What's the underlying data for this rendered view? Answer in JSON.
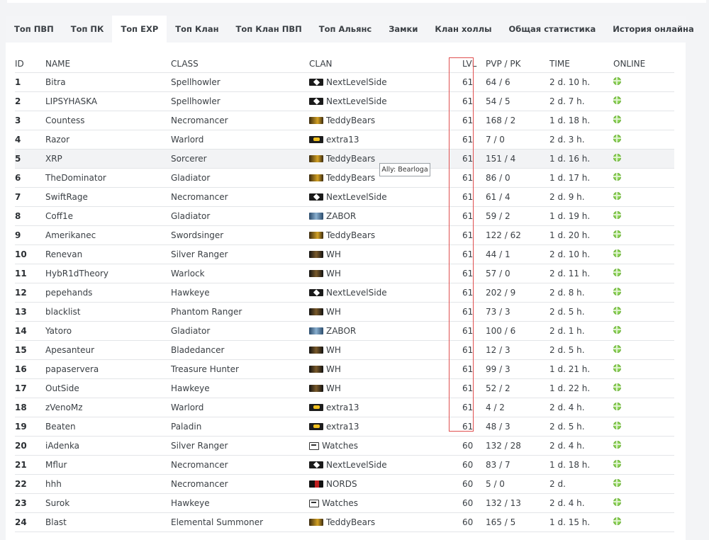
{
  "tabs": [
    {
      "label": "Топ ПВП",
      "active": false
    },
    {
      "label": "Топ ПК",
      "active": false
    },
    {
      "label": "Топ EXP",
      "active": true
    },
    {
      "label": "Топ Клан",
      "active": false
    },
    {
      "label": "Топ Клан ПВП",
      "active": false
    },
    {
      "label": "Топ Альянс",
      "active": false
    },
    {
      "label": "Замки",
      "active": false
    },
    {
      "label": "Клан холлы",
      "active": false
    },
    {
      "label": "Общая статистика",
      "active": false
    },
    {
      "label": "История онлайна",
      "active": false
    }
  ],
  "columns": [
    "ID",
    "NAME",
    "CLASS",
    "CLAN",
    "LVL",
    "PVP / PK",
    "TIME",
    "ONLINE"
  ],
  "rows": [
    {
      "id": "1",
      "name": "Bitra",
      "class": "Spellhowler",
      "clan": "NextLevelSide",
      "crest": "NextLevelSide-crest",
      "lvl": "61",
      "pvp": "64 / 6",
      "time": "2 d. 10 h."
    },
    {
      "id": "2",
      "name": "LIPSYHASKA",
      "class": "Spellhowler",
      "clan": "NextLevelSide",
      "crest": "NextLevelSide-crest",
      "lvl": "61",
      "pvp": "54 / 5",
      "time": "2 d. 7 h."
    },
    {
      "id": "3",
      "name": "Countess",
      "class": "Necromancer",
      "clan": "TeddyBears",
      "crest": "TeddyBears-crest",
      "lvl": "61",
      "pvp": "168 / 2",
      "time": "1 d. 18 h."
    },
    {
      "id": "4",
      "name": "Razor",
      "class": "Warlord",
      "clan": "extra13",
      "crest": "extra13-crest",
      "lvl": "61",
      "pvp": "7 / 0",
      "time": "2 d. 3 h."
    },
    {
      "id": "5",
      "name": "XRP",
      "class": "Sorcerer",
      "clan": "TeddyBears",
      "crest": "TeddyBears-crest",
      "lvl": "61",
      "pvp": "151 / 4",
      "time": "1 d. 16 h."
    },
    {
      "id": "6",
      "name": "TheDominator",
      "class": "Gladiator",
      "clan": "TeddyBears",
      "crest": "TeddyBears-crest",
      "lvl": "61",
      "pvp": "86 / 0",
      "time": "1 d. 17 h."
    },
    {
      "id": "7",
      "name": "SwiftRage",
      "class": "Necromancer",
      "clan": "NextLevelSide",
      "crest": "NextLevelSide-crest",
      "lvl": "61",
      "pvp": "61 / 4",
      "time": "2 d. 9 h."
    },
    {
      "id": "8",
      "name": "Coff1e",
      "class": "Gladiator",
      "clan": "ZABOR",
      "crest": "ZABOR-crest",
      "lvl": "61",
      "pvp": "59 / 2",
      "time": "1 d. 19 h."
    },
    {
      "id": "9",
      "name": "Amerikanec",
      "class": "Swordsinger",
      "clan": "TeddyBears",
      "crest": "TeddyBears-crest",
      "lvl": "61",
      "pvp": "122 / 62",
      "time": "1 d. 20 h."
    },
    {
      "id": "10",
      "name": "Renevan",
      "class": "Silver Ranger",
      "clan": "WH",
      "crest": "WH-crest",
      "lvl": "61",
      "pvp": "44 / 1",
      "time": "2 d. 10 h."
    },
    {
      "id": "11",
      "name": "HybR1dTheory",
      "class": "Warlock",
      "clan": "WH",
      "crest": "WH-crest",
      "lvl": "61",
      "pvp": "57 / 0",
      "time": "2 d. 11 h."
    },
    {
      "id": "12",
      "name": "pepehands",
      "class": "Hawkeye",
      "clan": "NextLevelSide",
      "crest": "NextLevelSide-crest",
      "lvl": "61",
      "pvp": "202 / 9",
      "time": "2 d. 8 h."
    },
    {
      "id": "13",
      "name": "blacklist",
      "class": "Phantom Ranger",
      "clan": "WH",
      "crest": "WH-crest",
      "lvl": "61",
      "pvp": "73 / 3",
      "time": "2 d. 5 h."
    },
    {
      "id": "14",
      "name": "Yatoro",
      "class": "Gladiator",
      "clan": "ZABOR",
      "crest": "ZABOR-crest",
      "lvl": "61",
      "pvp": "100 / 6",
      "time": "2 d. 1 h."
    },
    {
      "id": "15",
      "name": "Apesanteur",
      "class": "Bladedancer",
      "clan": "WH",
      "crest": "WH-crest",
      "lvl": "61",
      "pvp": "12 / 3",
      "time": "2 d. 5 h."
    },
    {
      "id": "16",
      "name": "papaservera",
      "class": "Treasure Hunter",
      "clan": "WH",
      "crest": "WH-crest",
      "lvl": "61",
      "pvp": "99 / 3",
      "time": "1 d. 21 h."
    },
    {
      "id": "17",
      "name": "OutSide",
      "class": "Hawkeye",
      "clan": "WH",
      "crest": "WH-crest",
      "lvl": "61",
      "pvp": "52 / 2",
      "time": "1 d. 22 h."
    },
    {
      "id": "18",
      "name": "zVenoMz",
      "class": "Warlord",
      "clan": "extra13",
      "crest": "extra13-crest",
      "lvl": "61",
      "pvp": "4 / 2",
      "time": "2 d. 4 h."
    },
    {
      "id": "19",
      "name": "Beaten",
      "class": "Paladin",
      "clan": "extra13",
      "crest": "extra13-crest",
      "lvl": "61",
      "pvp": "48 / 3",
      "time": "2 d. 5 h."
    },
    {
      "id": "20",
      "name": "iAdenka",
      "class": "Silver Ranger",
      "clan": "Watches",
      "crest": "Watches-crest",
      "lvl": "60",
      "pvp": "132 / 28",
      "time": "2 d. 4 h."
    },
    {
      "id": "21",
      "name": "Mflur",
      "class": "Necromancer",
      "clan": "NextLevelSide",
      "crest": "NextLevelSide-crest",
      "lvl": "60",
      "pvp": "83 / 7",
      "time": "1 d. 18 h."
    },
    {
      "id": "22",
      "name": "hhh",
      "class": "Necromancer",
      "clan": "NORDS",
      "crest": "NORDS-crest",
      "lvl": "60",
      "pvp": "5 / 0",
      "time": "2 d."
    },
    {
      "id": "23",
      "name": "Surok",
      "class": "Hawkeye",
      "clan": "Watches",
      "crest": "Watches-crest",
      "lvl": "60",
      "pvp": "132 / 13",
      "time": "2 d. 4 h."
    },
    {
      "id": "24",
      "name": "Blast",
      "class": "Elemental Summoner",
      "clan": "TeddyBears",
      "crest": "TeddyBears-crest",
      "lvl": "60",
      "pvp": "165 / 5",
      "time": "1 d. 15 h."
    }
  ],
  "hover_row": 4,
  "tooltip": {
    "text": "Ally: Bearloga"
  },
  "colors": {
    "highlight_border": "#e05050",
    "online": "#8fd45a",
    "active_tab_bg": "#ffffff"
  }
}
